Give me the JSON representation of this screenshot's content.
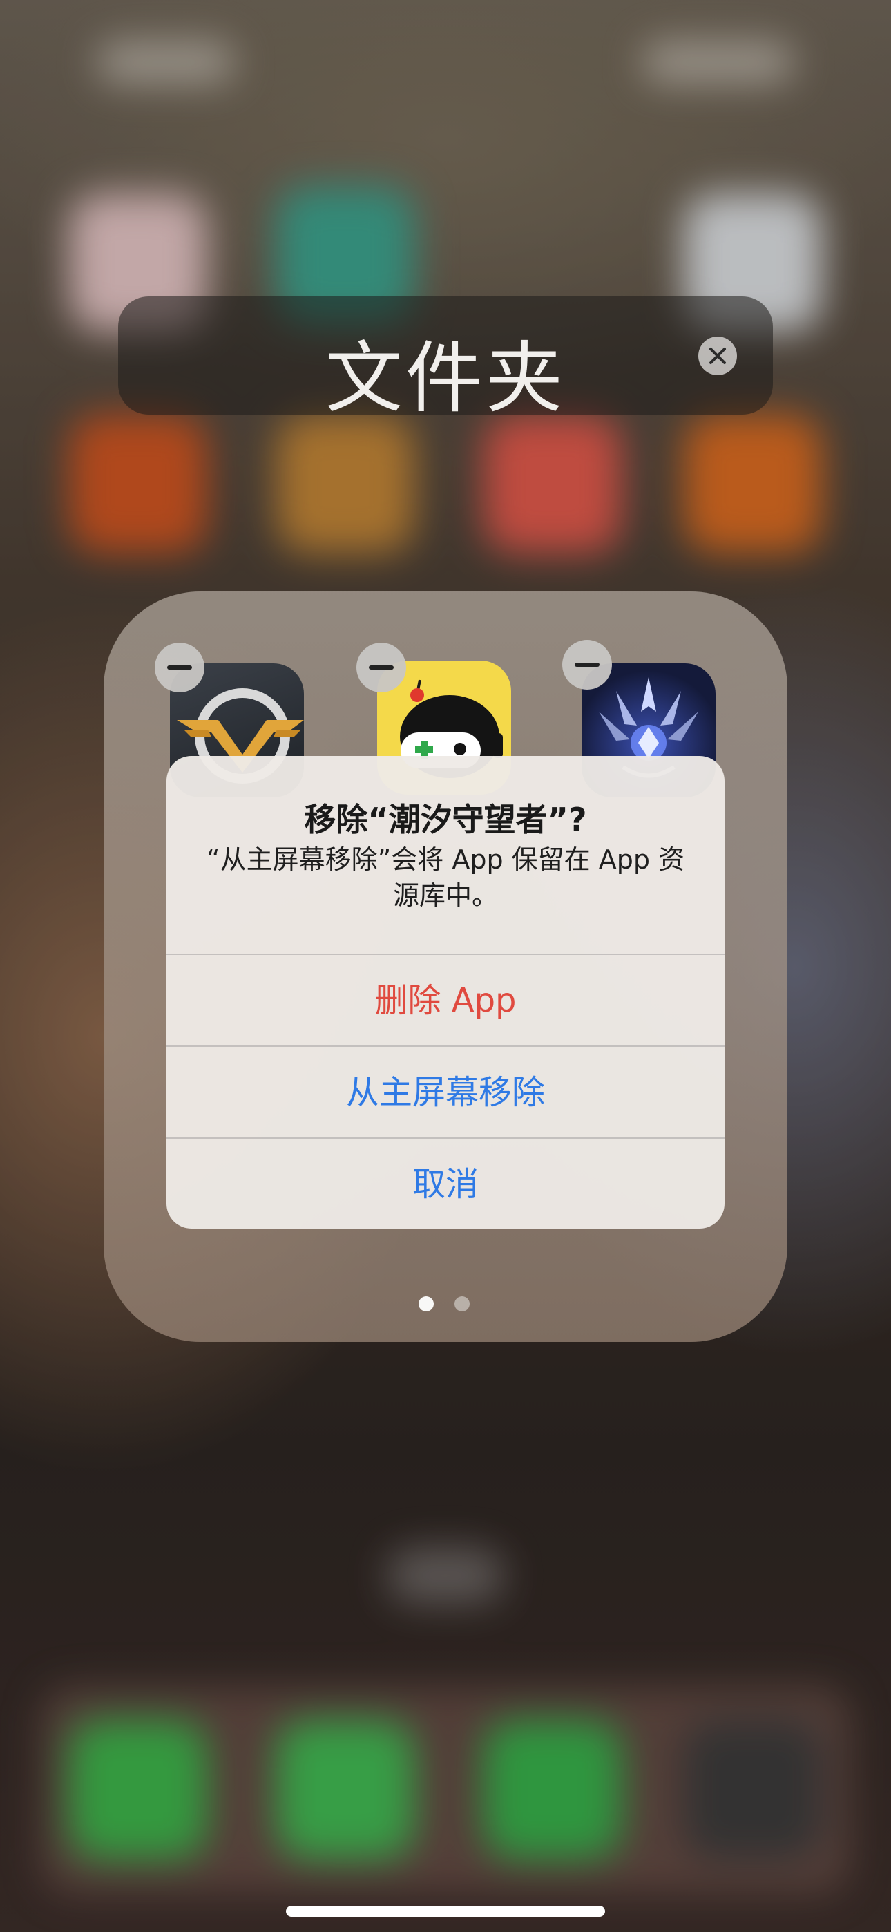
{
  "folder": {
    "title": "文件夹",
    "clear_icon": "xmark-circle-icon"
  },
  "apps": [
    {
      "name": "winged-v-app",
      "icon": "winged-v-icon",
      "remove_icon": "minus-circle-icon"
    },
    {
      "name": "game-robot-app",
      "icon": "game-robot-icon",
      "remove_icon": "minus-circle-icon"
    },
    {
      "name": "crystal-crown-app",
      "icon": "crystal-crown-icon",
      "remove_icon": "minus-circle-icon"
    }
  ],
  "page_indicator": {
    "pages": 2,
    "current": 1
  },
  "alert": {
    "title": "移除“潮汐守望者”?",
    "message": "“从主屏幕移除”会将 App 保留在 App 资源库中。",
    "buttons": {
      "delete": "删除 App",
      "remove": "从主屏幕移除",
      "cancel": "取消"
    }
  },
  "colors": {
    "destructive": "#e04a3f",
    "accent": "#2f7ae5"
  }
}
